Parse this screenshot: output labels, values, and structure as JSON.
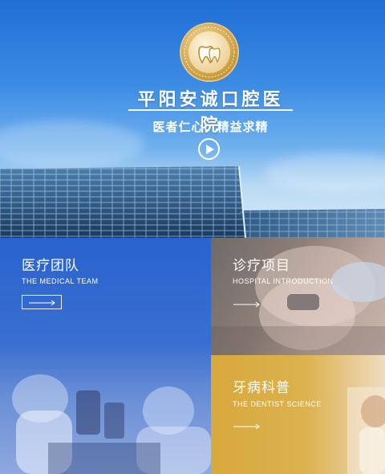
{
  "hero": {
    "logo_icon": "tooth-logo-icon",
    "hospital_name": "平阳安诚口腔医院",
    "slogan": "医者仁心、精益求精",
    "play_icon": "play-icon"
  },
  "tiles": [
    {
      "title": "医疗团队",
      "subtitle": "THE MEDICAL TEAM",
      "color": "#2f66cf"
    },
    {
      "title": "诊疗项目",
      "subtitle": "HOSPITAL INTRODUCTION",
      "color": "#8a7d77"
    },
    {
      "title": "牙病科普",
      "subtitle": "THE DENTIST SCIENCE",
      "color": "#d8aa40"
    }
  ],
  "colors": {
    "hero_blue": "#1f6fd6",
    "gold": "#d8aa40"
  }
}
